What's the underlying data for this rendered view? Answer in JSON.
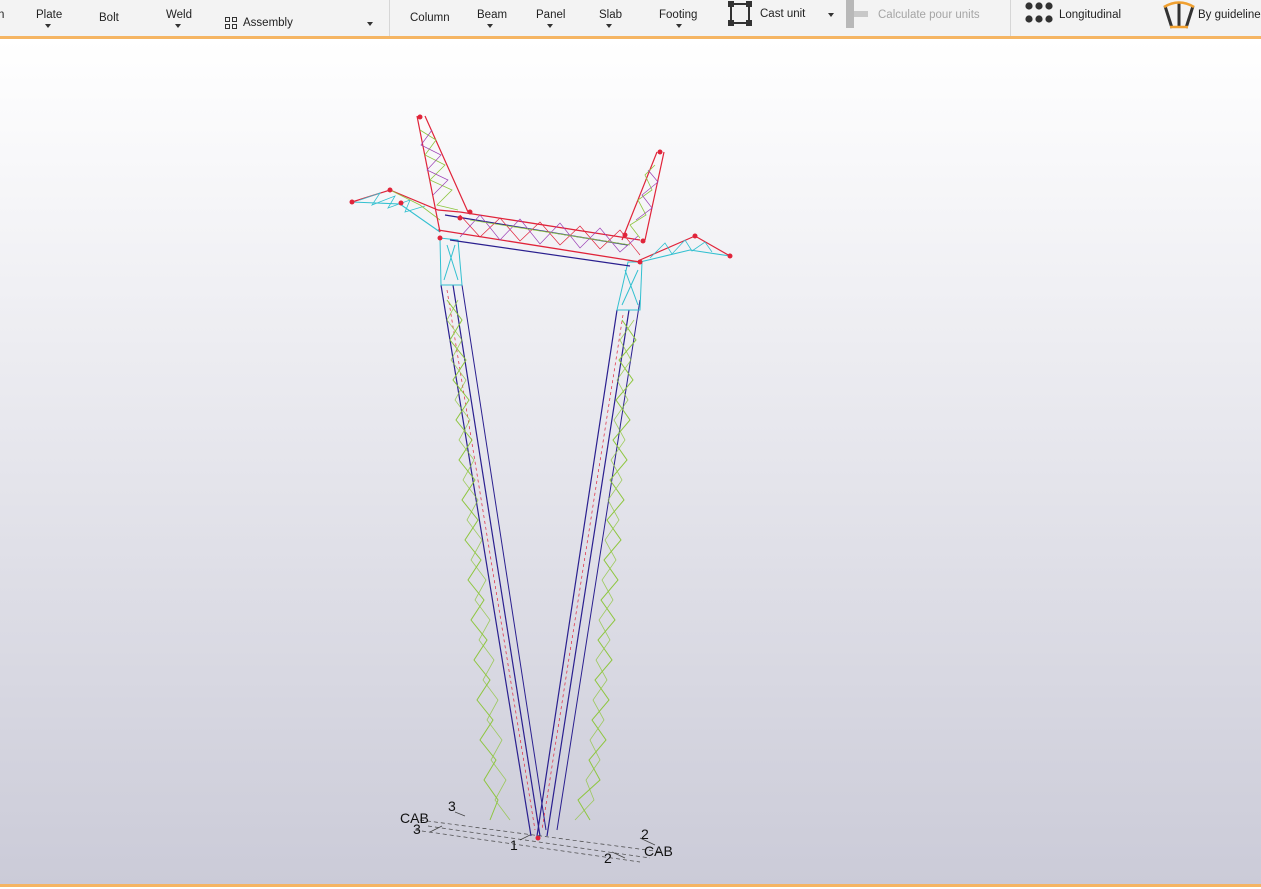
{
  "ribbon": {
    "left_fragment": "n",
    "items": {
      "plate": "Plate",
      "bolt": "Bolt",
      "weld": "Weld",
      "assembly": "Assembly",
      "column": "Column",
      "beam": "Beam",
      "panel": "Panel",
      "slab": "Slab",
      "footing": "Footing",
      "cast_unit": "Cast unit",
      "calculate_pour_units": "Calculate pour units",
      "longitudinal": "Longitudinal",
      "by_guideline": "By guideline"
    }
  },
  "grid_labels": {
    "left_axis": "CAB",
    "right_axis": "CAB",
    "n3_top": "3",
    "n3_left": "3",
    "n1": "1",
    "n2_right": "2",
    "n2_bottom": "2"
  },
  "colors": {
    "accent": "#f5b563",
    "member_blue": "#2a1f8f",
    "member_red": "#e0243a",
    "member_green": "#8ec63f",
    "member_cyan": "#33c0d0",
    "member_purple": "#9b3fb5"
  }
}
